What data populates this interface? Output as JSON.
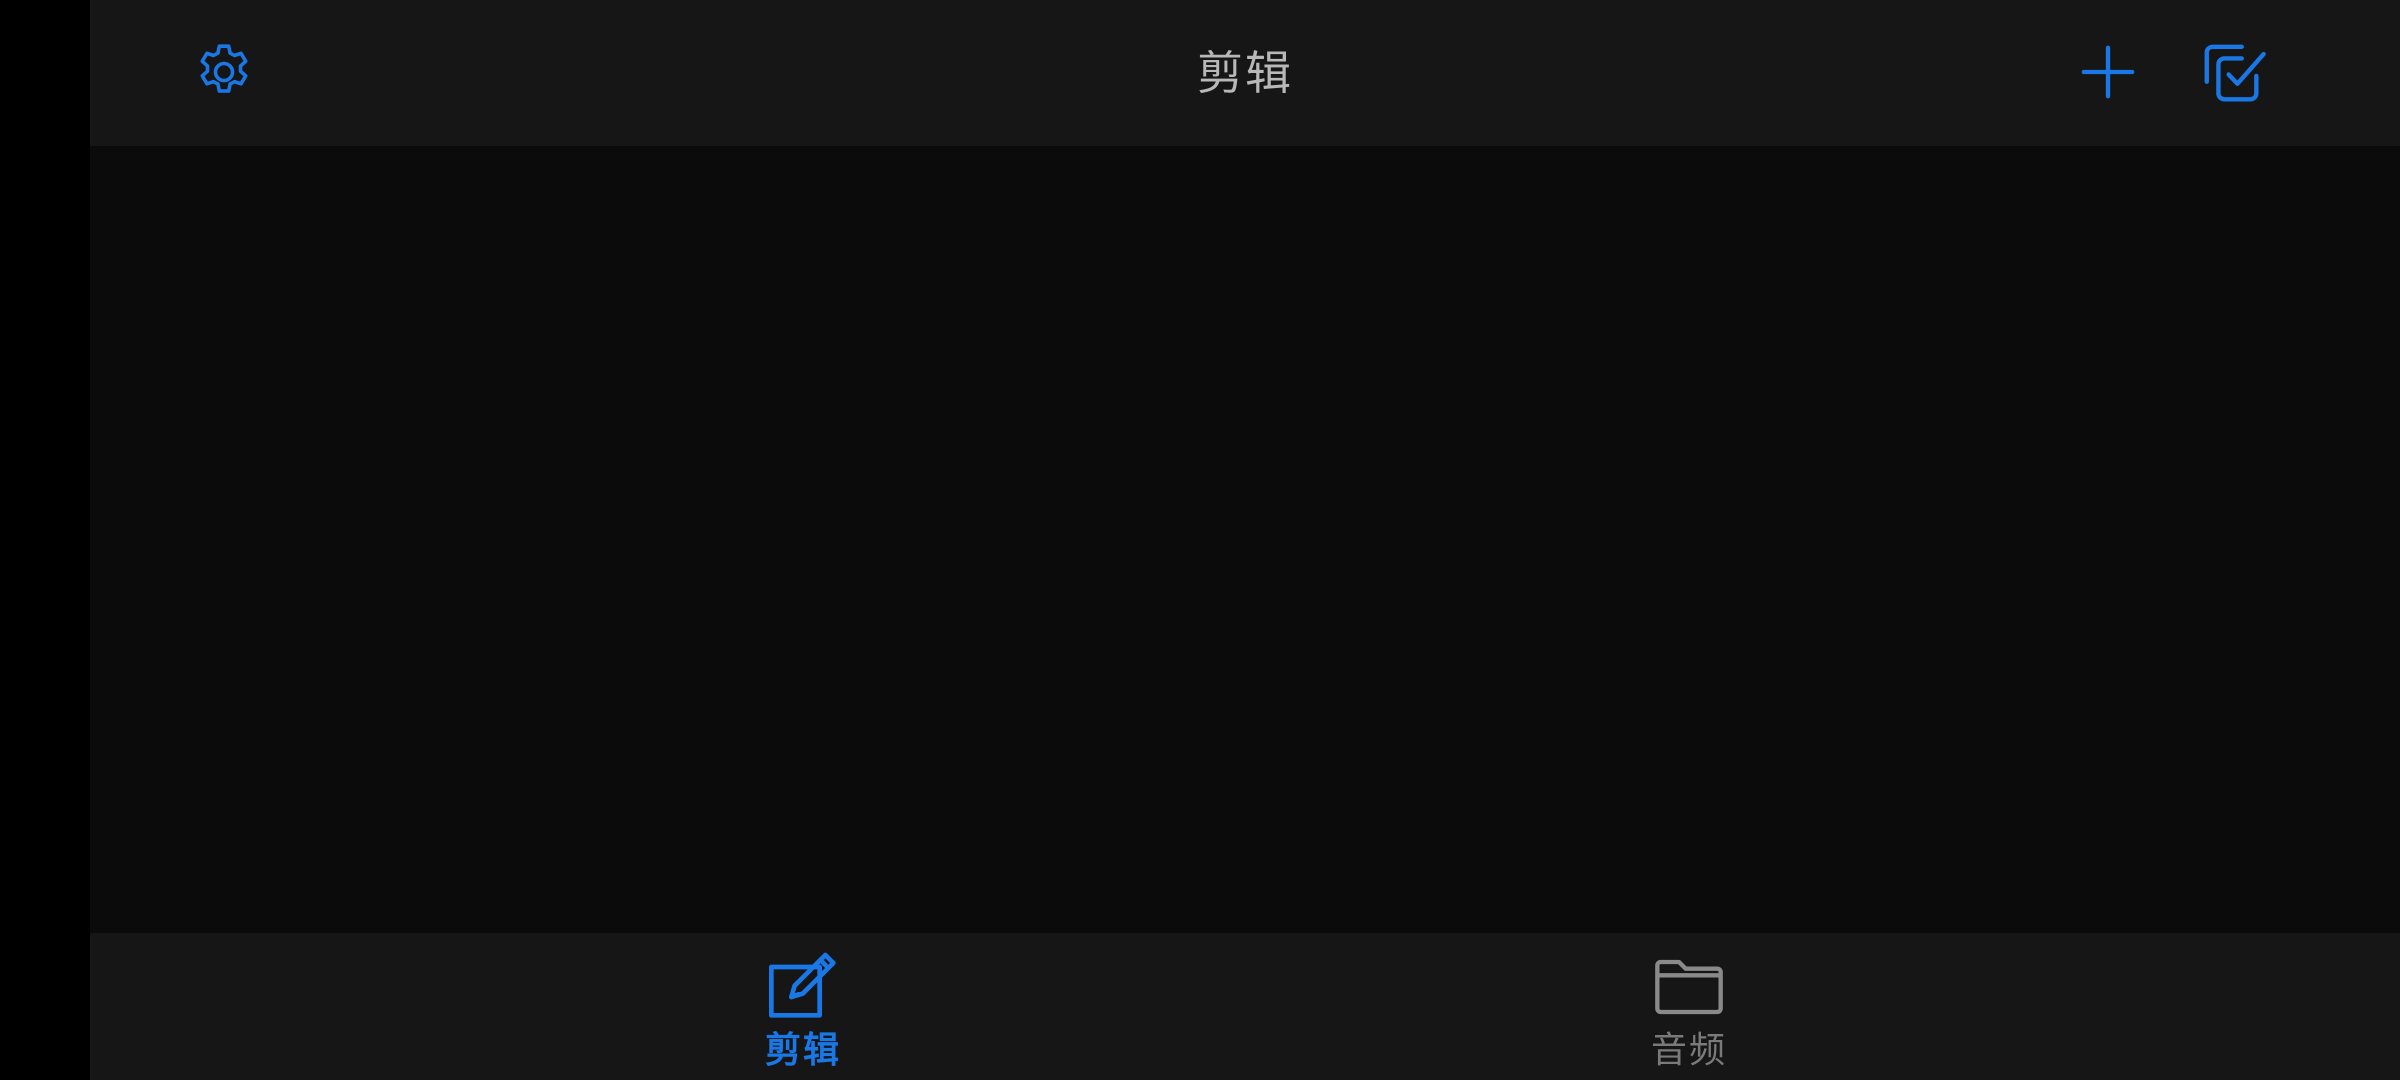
{
  "header": {
    "title": "剪辑",
    "settings_icon": "gear-icon",
    "add_icon": "plus-icon",
    "select_icon": "multi-select-check-icon"
  },
  "tabs": [
    {
      "label": "剪辑",
      "icon": "edit-pencil-icon",
      "active": true
    },
    {
      "label": "音频",
      "icon": "folder-icon",
      "active": false
    }
  ],
  "colors": {
    "accent": "#1a78e6",
    "inactive": "#7a7a7a",
    "title_text": "#b8b8b8",
    "bar_background": "#161616",
    "content_background": "#0b0b0b"
  }
}
